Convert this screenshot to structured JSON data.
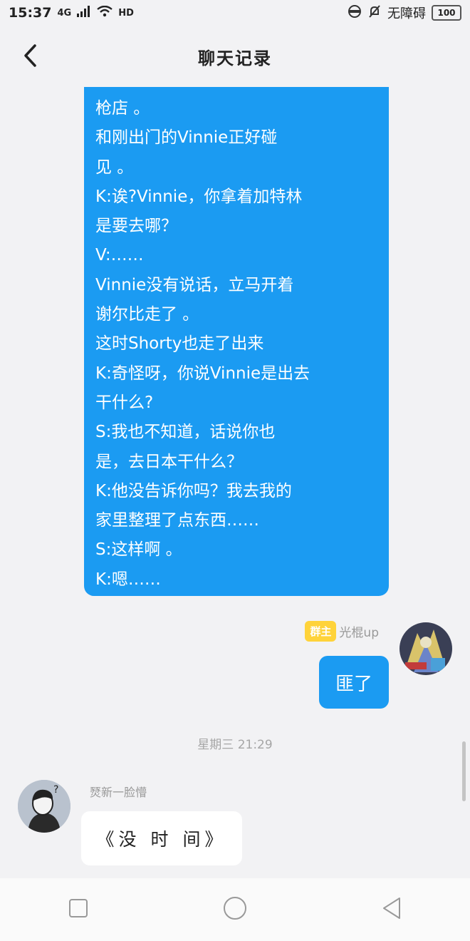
{
  "status_bar": {
    "time": "15:37",
    "network": "4G",
    "hd": "HD",
    "accessibility": "无障碍",
    "battery": "100"
  },
  "header": {
    "title": "聊天记录"
  },
  "messages": {
    "long_text": "枪店 。\n和刚出门的Vinnie正好碰\n见 。\nK:诶?Vinnie，你拿着加特林\n是要去哪？\nV:……\nVinnie没有说话，立马开着\n谢尔比走了 。\n这时Shorty也走了出来\nK:奇怪呀，你说Vinnie是出去\n干什么?\nS:我也不知道，话说你也\n是，去日本干什么？\nK:他没告诉你吗？我去我的\n家里整理了点东西……\nS:这样啊 。\nK:嗯……",
    "sender_badge": "群主",
    "sender_name": "光棍up",
    "short_reply": "匪了",
    "time_divider": "星期三 21:29",
    "left_sender_name": "燹新一脸懵",
    "left_text": "《没 时 间》"
  },
  "colors": {
    "bubble_blue": "#1b9bf2",
    "badge_yellow": "#ffd33a",
    "background": "#f2f2f4"
  }
}
